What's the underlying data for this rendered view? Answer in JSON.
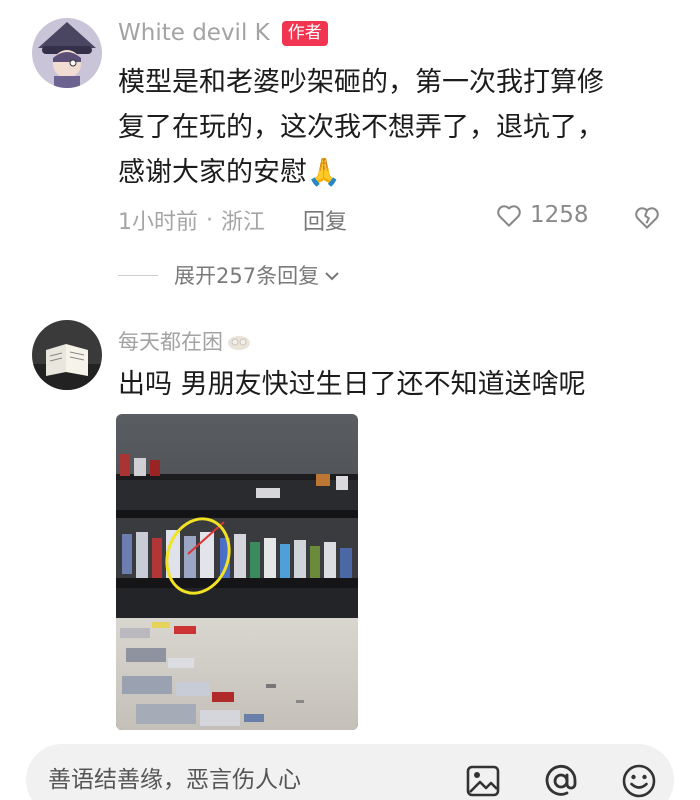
{
  "comments": [
    {
      "author": "White devil  K",
      "badge": "作者",
      "text_lines": [
        "模型是和老婆吵架砸的，第一次我打算修",
        "复了在玩的，这次我不想弄了，退坑了，",
        "感谢大家的安慰🙏"
      ],
      "time": "1小时前",
      "location": "浙江",
      "reply_label": "回复",
      "likes": "1258",
      "expand_label": "展开257条回复"
    },
    {
      "author": "每天都在困",
      "text": "出吗  男朋友快过生日了还不知道送啥呢"
    }
  ],
  "input": {
    "placeholder": "善语结善缘，恶言伤人心"
  },
  "icons": [
    "heart-icon",
    "broken-heart-icon",
    "chevron-down-icon",
    "image-icon",
    "at-icon",
    "emoji-icon"
  ],
  "colors": {
    "badge": "#f1344f",
    "text": "#1c1c1c",
    "muted": "#a5a5a5",
    "input_bg": "#f1f1f1"
  }
}
